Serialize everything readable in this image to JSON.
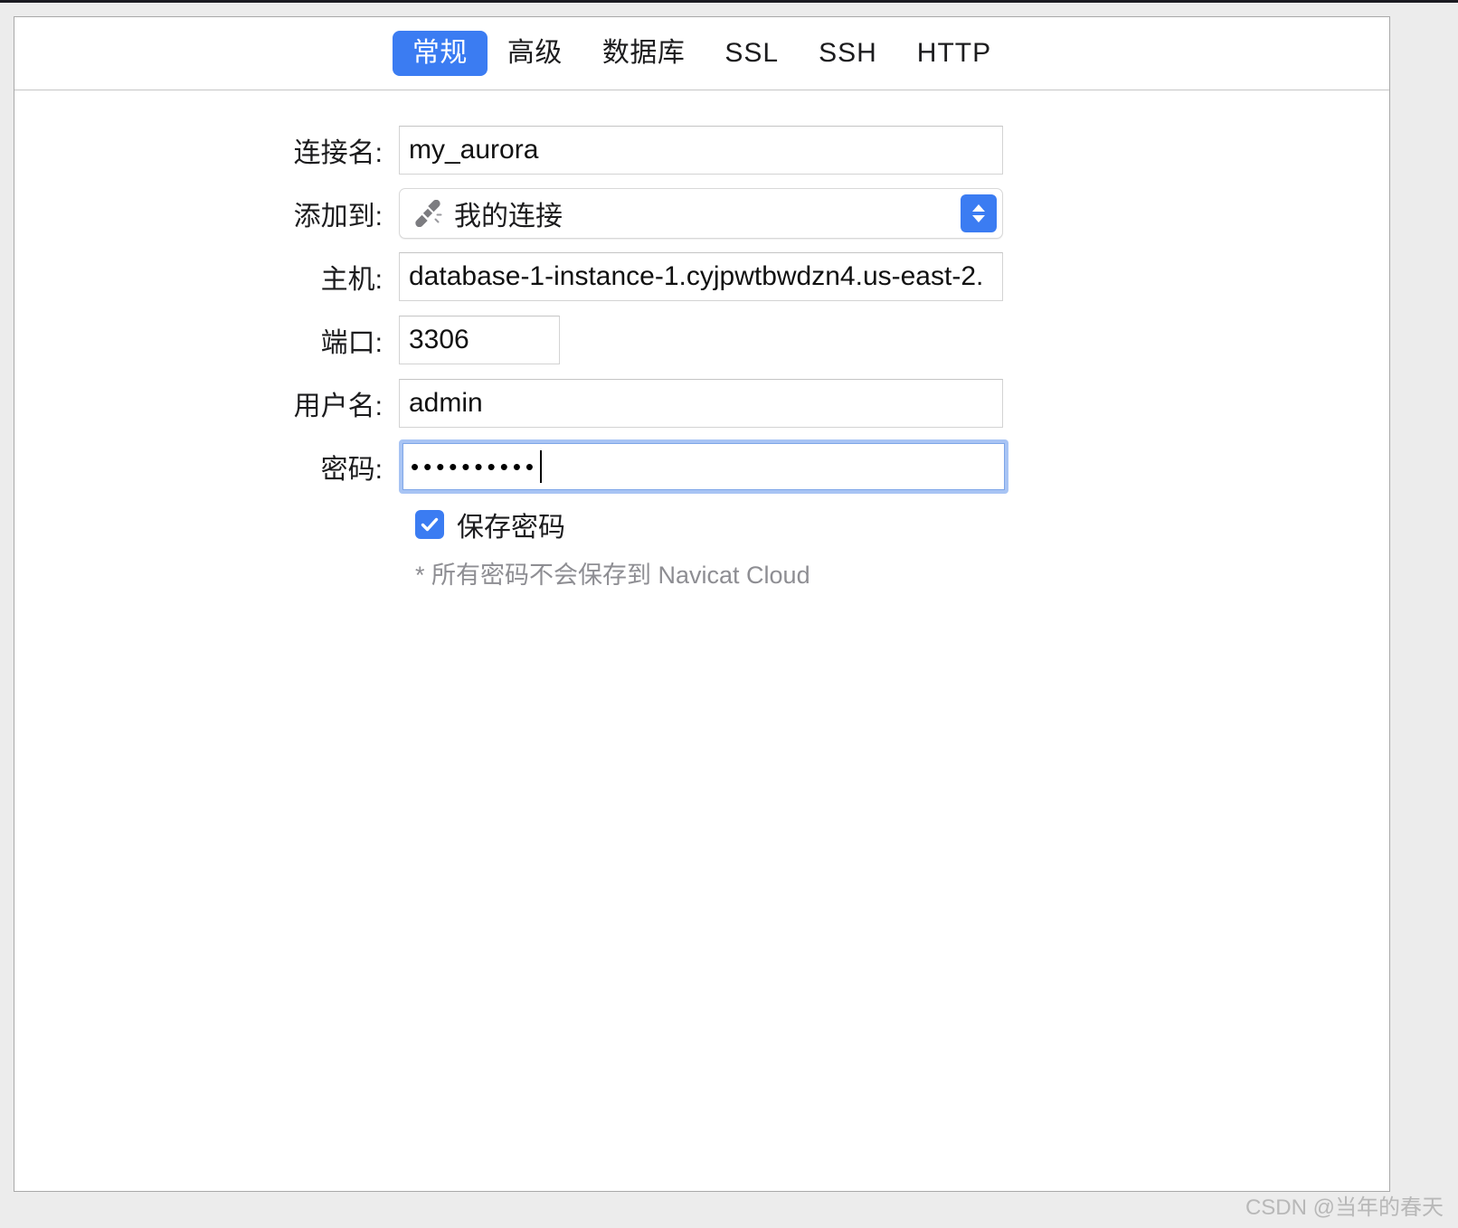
{
  "window": {
    "title": "",
    "accent_color": "#3b7cf2",
    "panel_bg": "#ffffff",
    "desktop_bg": "#ececec"
  },
  "tabs": [
    {
      "label": "常规",
      "active": true
    },
    {
      "label": "高级",
      "active": false
    },
    {
      "label": "数据库",
      "active": false
    },
    {
      "label": "SSL",
      "active": false
    },
    {
      "label": "SSH",
      "active": false
    },
    {
      "label": "HTTP",
      "active": false
    }
  ],
  "form": {
    "connection_name": {
      "label": "连接名:",
      "value": "my_aurora",
      "placeholder": ""
    },
    "add_to": {
      "label": "添加到:",
      "value": "我的连接",
      "icon": "plug-icon",
      "options": [
        "我的连接"
      ]
    },
    "host": {
      "label": "主机:",
      "value": "database-1-instance-1.cyjpwtbwdzn4.us-east-2.",
      "placeholder": ""
    },
    "port": {
      "label": "端口:",
      "value": "3306",
      "placeholder": ""
    },
    "username": {
      "label": "用户名:",
      "value": "admin",
      "placeholder": ""
    },
    "password": {
      "label": "密码:",
      "value": "••••••••••",
      "placeholder": "",
      "focused": true,
      "char_count": 10
    },
    "save_password": {
      "label": "保存密码",
      "checked": true
    },
    "hint": "* 所有密码不会保存到 Navicat Cloud"
  },
  "watermark": "CSDN @当年的春天"
}
